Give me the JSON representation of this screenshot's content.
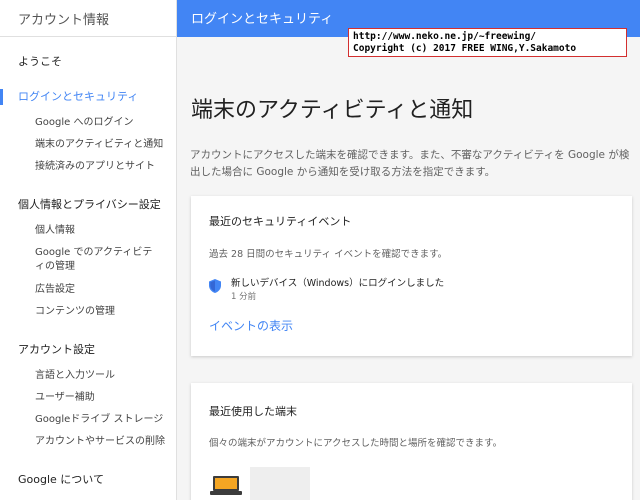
{
  "sidebar": {
    "title": "アカウント情報",
    "welcome": "ようこそ",
    "sections": [
      {
        "title": "ログインとセキュリティ",
        "active": true,
        "items": [
          "Google へのログイン",
          "端末のアクティビティと通知",
          "接続済みのアプリとサイト"
        ]
      },
      {
        "title": "個人情報とプライバシー設定",
        "active": false,
        "items": [
          "個人情報",
          "Google でのアクティビティの管理",
          "広告設定",
          "コンテンツの管理"
        ]
      },
      {
        "title": "アカウント設定",
        "active": false,
        "items": [
          "言語と入力ツール",
          "ユーザー補助",
          "Googleドライブ ストレージ",
          "アカウントやサービスの削除"
        ]
      }
    ],
    "about": "Google について"
  },
  "header": {
    "title": "ログインとセキュリティ"
  },
  "stamp": {
    "line1": "http://www.neko.ne.jp/~freewing/",
    "line2": "Copyright (c) 2017 FREE WING,Y.Sakamoto"
  },
  "main": {
    "title": "端末のアクティビティと通知",
    "description": "アカウントにアクセスした端末を確認できます。また、不審なアクティビティを Google が検出した場合に Google から通知を受け取る方法を指定できます。",
    "security_card": {
      "title": "最近のセキュリティイベント",
      "text": "過去 28 日間のセキュリティ イベントを確認できます。",
      "event_text": "新しいデバイス（Windows）にログインしました",
      "event_time": "1 分前",
      "link": "イベントの表示"
    },
    "devices_card": {
      "title": "最近使用した端末",
      "text": "個々の端末がアカウントにアクセスした時間と場所を確認できます。"
    }
  },
  "colors": {
    "accent": "#4285f4",
    "background": "#f5f5f5",
    "card": "#ffffff",
    "laptop": "#f5a623"
  },
  "icons": {
    "event": "shield-icon",
    "device": "laptop-icon"
  }
}
